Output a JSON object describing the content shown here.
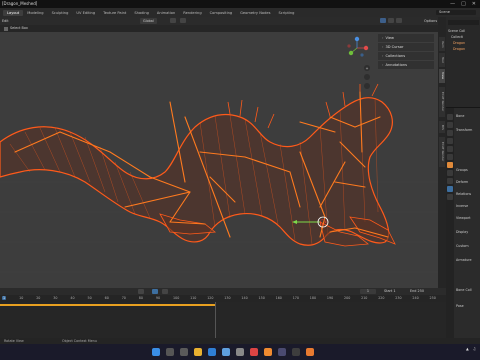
{
  "window": {
    "title": "[Dragon_Meshed]"
  },
  "workspace_tabs": [
    "Layout",
    "Modeling",
    "Sculpting",
    "UV Editing",
    "Texture Paint",
    "Shading",
    "Animation",
    "Rendering",
    "Compositing",
    "Geometry Nodes",
    "Scripting"
  ],
  "active_tab": "Layout",
  "scene": {
    "label": "Scene"
  },
  "viewport_header": {
    "mode": "Edit",
    "global": "Global",
    "options": "Options"
  },
  "tool_header": {
    "select_box": "Select Box"
  },
  "overlay_panel": {
    "items": [
      "View",
      "3D Cursor",
      "Collections",
      "Annotations"
    ]
  },
  "side_tabs": [
    "Item",
    "Tool",
    "View",
    "ECAT Render",
    "BIS",
    "ECAT Render"
  ],
  "outliner": {
    "rows": [
      "Scene Coll",
      "Collecti",
      "Dragon",
      "Dragon"
    ]
  },
  "timeline": {
    "frame_start": "1",
    "current_frame": "1",
    "start_label": "Start",
    "start_value": "1",
    "end_label": "End",
    "end_value": "250",
    "ticks": [
      "0",
      "10",
      "20",
      "30",
      "40",
      "50",
      "60",
      "70",
      "80",
      "90",
      "100",
      "110",
      "120",
      "130",
      "140",
      "150",
      "160",
      "170",
      "180",
      "190",
      "200",
      "210",
      "220",
      "230",
      "240",
      "250"
    ]
  },
  "properties": {
    "rows": [
      "Bone",
      "Transform",
      "Groups",
      "Deform",
      "Relations",
      "Inverse",
      "Viewport",
      "Display",
      "Custom",
      "Armature",
      "Bone Coll",
      "Pose"
    ]
  },
  "status": {
    "left": "Rotate View",
    "middle": "Object Context Menu"
  },
  "colors": {
    "dragon": "#ff5a1a",
    "bones": "#ff7a1f",
    "viewport_bg": "#3d3d3d",
    "timeline_bar": "#e8a020"
  }
}
